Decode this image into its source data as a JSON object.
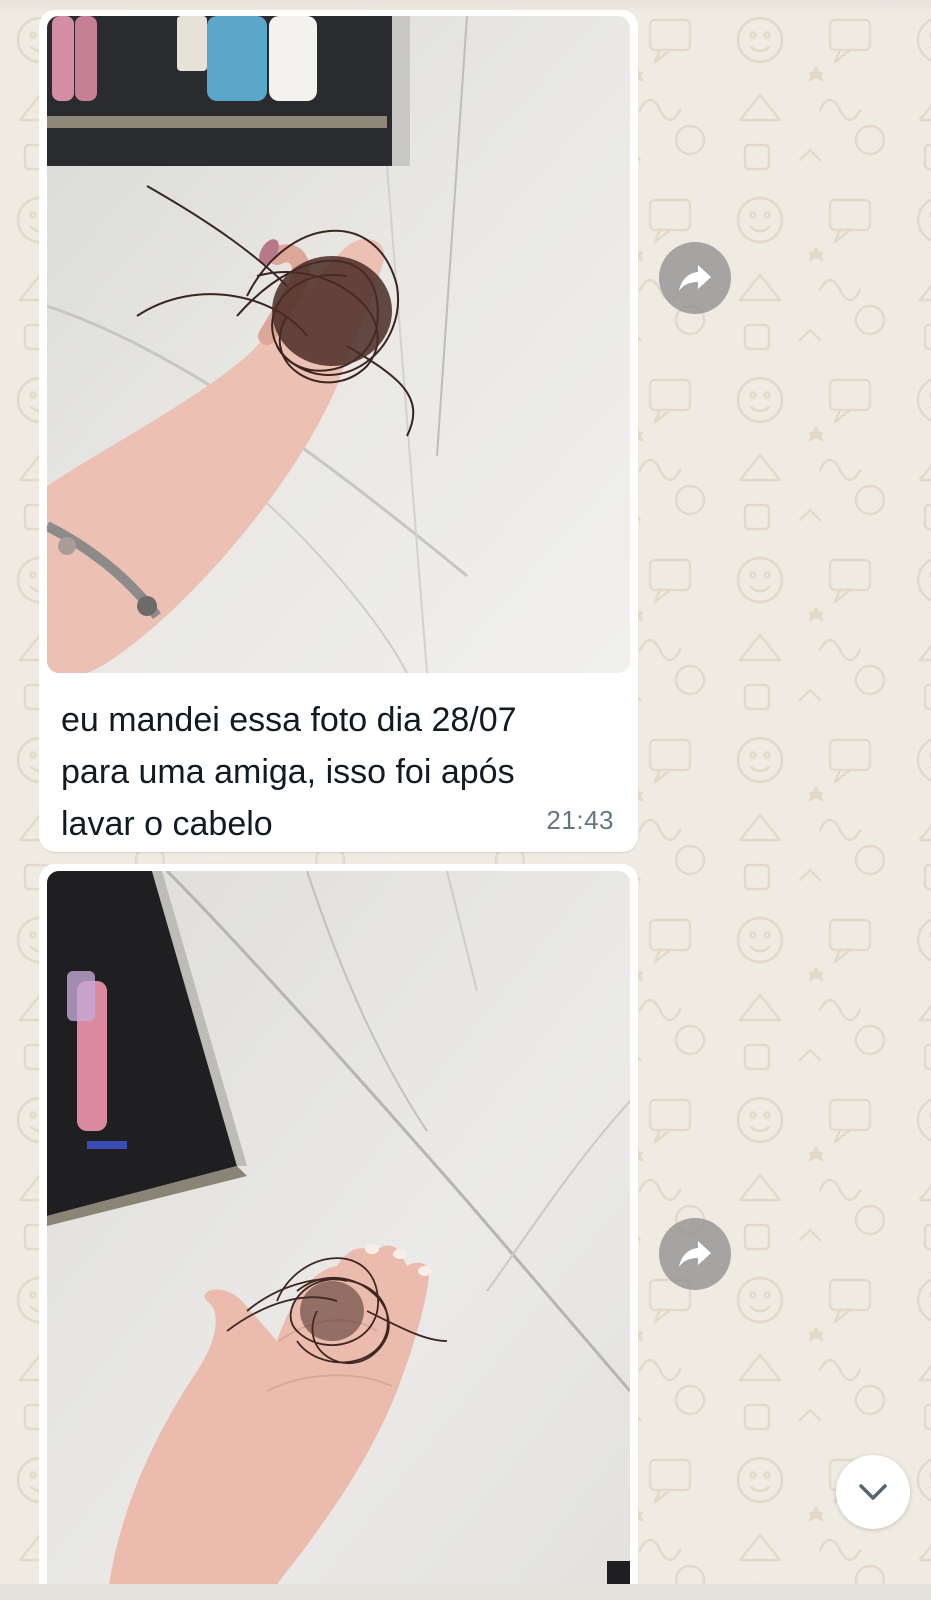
{
  "chat": {
    "messages": [
      {
        "type": "image",
        "image_icon": "photo-hand-holding-hair-clump",
        "caption": "eu mandei essa foto dia 28/07\npara uma amiga, isso foi após\nlavar o cabelo",
        "time": "21:43"
      },
      {
        "type": "image",
        "image_icon": "photo-hand-palm-with-hair"
      }
    ],
    "forward_icon": "forward-arrow-icon",
    "scroll_icon": "chevron-down-icon"
  },
  "colors": {
    "wallpaper": "#efeae2",
    "bubble": "#ffffff",
    "text": "#111b21",
    "meta": "#667781"
  }
}
